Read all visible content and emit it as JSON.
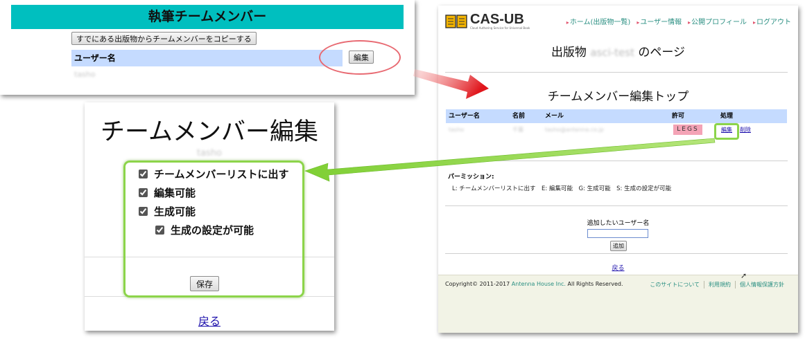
{
  "panel_a": {
    "title": "執筆チームメンバー",
    "copy_button_label": "すでにある出版物からチームメンバーをコピーする",
    "column_header": "ユーザー名",
    "username_blurred": "tasho",
    "edit_button_label": "編集"
  },
  "panel_b": {
    "title": "チームメンバー編集",
    "username_blurred": "tasho",
    "permissions": [
      {
        "label": "チームメンバーリストに出す",
        "checked": true
      },
      {
        "label": "編集可能",
        "checked": true
      },
      {
        "label": "生成可能",
        "checked": true
      },
      {
        "label": "生成の設定が可能",
        "checked": true
      }
    ],
    "save_button_label": "保存",
    "back_link": "戻る"
  },
  "panel_c": {
    "logo_text": "CAS-UB",
    "logo_tagline": "Cloud Authoring Service for Universal Book",
    "nav": [
      "ホーム(出版物一覧)",
      "ユーザー情報",
      "公開プロフィール",
      "ログアウト"
    ],
    "publication_title_prefix": "出版物",
    "publication_name_blurred": "asci-test",
    "publication_title_suffix": "のページ",
    "team_title": "チームメンバー編集トップ",
    "table": {
      "headers": [
        "ユーザー名",
        "名前",
        "メール",
        "許可",
        "処理"
      ],
      "row": {
        "username_blurred": "tasho",
        "name_blurred": "千葉",
        "email_blurred": "tasho@antenna.co.jp",
        "permissions": "LEGS",
        "edit_link": "編集",
        "delete_link": "削除"
      }
    },
    "permission_title": "パーミッション:",
    "permission_desc": "L: チームメンバーリストに出す　E: 編集可能　G: 生成可能　S: 生成の設定が可能",
    "add_user_label": "追加したいユーザー名",
    "add_user_value": "",
    "add_button_label": "追加",
    "back_link": "戻る",
    "footer": {
      "copyright_prefix": "Copyright© 2011-2017 ",
      "company": "Antenna House Inc.",
      "copyright_suffix": " All Rights Reserved.",
      "links": [
        "このサイトについて",
        "利用規約",
        "個人情報保護方針"
      ]
    }
  },
  "colors": {
    "teal_bar": "#00bfbf",
    "table_header": "#c5dbff",
    "legs_badge": "#f4a3b6",
    "highlight_green": "#8cd44a",
    "highlight_red": "#e86a72",
    "link_teal": "#2a8f82",
    "footer_bg": "#f2f3e6"
  }
}
